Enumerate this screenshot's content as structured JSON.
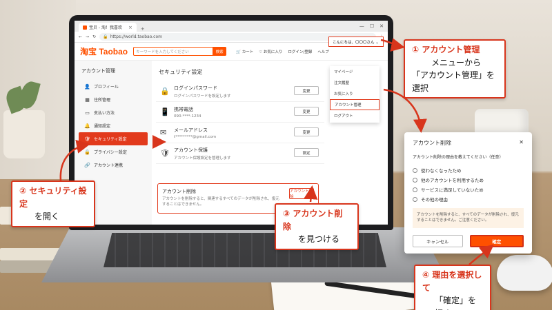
{
  "browser": {
    "tab_title": "宝贝 - 淘！我喜欢",
    "tab_close": "×",
    "new_tab": "+",
    "url": "https://world.taobao.com",
    "window_controls": [
      "—",
      "☐",
      "✕"
    ]
  },
  "site": {
    "logo": "淘宝 Taobao",
    "search_placeholder": "キーワードを入力してください",
    "search_button": "検索",
    "links": [
      "🛒 カート",
      "♡ お気に入り",
      "ログイン/登録",
      "ヘルプ"
    ],
    "greeting": "こんにちは、〇〇〇さん ⌄"
  },
  "account_menu": {
    "items": [
      "マイページ",
      "注文履歴",
      "お気に入り",
      "アカウント管理",
      "ログアウト"
    ],
    "highlighted_index": 3
  },
  "sidebar": {
    "title": "アカウント管理",
    "items": [
      {
        "icon": "👤",
        "label": "プロフィール"
      },
      {
        "icon": "▦",
        "label": "住所管理"
      },
      {
        "icon": "▭",
        "label": "支払い方法"
      },
      {
        "icon": "🔔",
        "label": "通知設定"
      },
      {
        "icon": "🛡",
        "label": "セキュリティ設定"
      },
      {
        "icon": "🔒",
        "label": "プライバシー設定"
      },
      {
        "icon": "🔗",
        "label": "アカウント連携"
      }
    ],
    "active_index": 4
  },
  "security": {
    "title": "セキュリティ設定",
    "rows": [
      {
        "icon": "🔒",
        "label": "ログインパスワード",
        "sub": "ログインパスワードを設定します",
        "button": "変更"
      },
      {
        "icon": "📱",
        "label": "携帯電話",
        "sub": "090-****-1234",
        "button": "変更"
      },
      {
        "icon": "✉",
        "label": "メールアドレス",
        "sub": "t*********@gmail.com",
        "button": "変更"
      },
      {
        "icon": "🛡",
        "label": "アカウント保護",
        "sub": "アカウント保護設定を管理します",
        "button": "設定"
      }
    ],
    "delete": {
      "label": "アカウント削除",
      "desc": "アカウントを削除すると、関連するすべてのデータが削除され、復元することはできません。",
      "button": "アカウント削除"
    }
  },
  "dialog": {
    "title": "アカウント削除",
    "close": "✕",
    "question": "アカウント削除の理由を教えてください（任意）",
    "options": [
      "使わなくなったため",
      "他のアカウントを利用するため",
      "サービスに満足していないため",
      "その他の理由"
    ],
    "warning": "アカウントを削除すると、すべてのデータが削除され、復元することはできません。ご注意ください。",
    "cancel": "キャンセル",
    "confirm": "確定"
  },
  "callouts": [
    {
      "title": "① アカウント管理",
      "body1": "メニューから",
      "body2": "「アカウント管理」を選択"
    },
    {
      "title": "② セキュリティ設定",
      "body1": "を開く"
    },
    {
      "title": "③ アカウント削除",
      "body1": "を見つける"
    },
    {
      "title": "④ 理由を選択して",
      "body1": "「確定」を押す"
    }
  ],
  "colors": {
    "accent": "#ff5000",
    "highlight": "#d8351c"
  }
}
